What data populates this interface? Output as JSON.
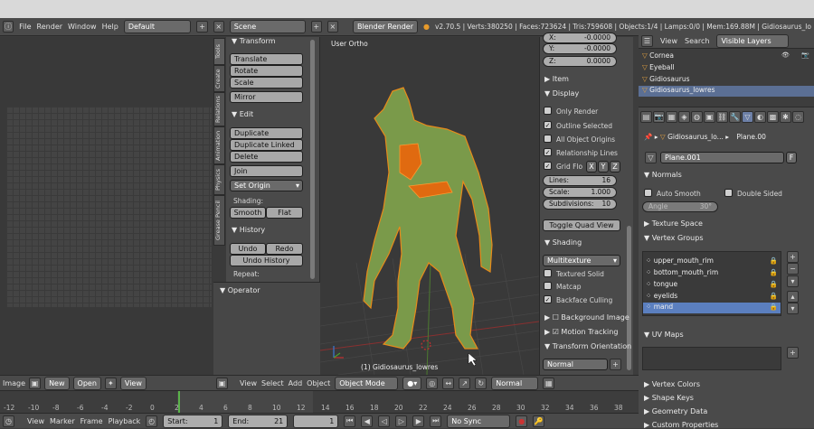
{
  "header": {
    "menus": [
      "File",
      "Render",
      "Window",
      "Help"
    ],
    "layout": "Default",
    "scene": "Scene",
    "engine": "Blender Render",
    "stats": "v2.70.5 | Verts:380250 | Faces:723624 | Tris:759608 | Objects:1/4 | Lamps:0/0 | Mem:169.88M | Gidiosaurus_lo"
  },
  "tool_tabs": [
    "Tools",
    "Create",
    "Relations",
    "Animation",
    "Physics",
    "Grease Pencil"
  ],
  "tools": {
    "transform_title": "Transform",
    "translate": "Translate",
    "rotate": "Rotate",
    "scale": "Scale",
    "mirror": "Mirror",
    "edit_title": "Edit",
    "duplicate": "Duplicate",
    "duplicate_linked": "Duplicate Linked",
    "delete": "Delete",
    "join": "Join",
    "set_origin": "Set Origin",
    "shading_label": "Shading:",
    "smooth": "Smooth",
    "flat": "Flat",
    "history_title": "History",
    "undo": "Undo",
    "redo": "Redo",
    "undo_history": "Undo History",
    "repeat_label": "Repeat:",
    "operator_title": "Operator"
  },
  "viewport": {
    "view_label": "User Ortho",
    "object_label": "(1) Gidiosaurus_lowres",
    "menus": [
      "View",
      "Select",
      "Add",
      "Object"
    ],
    "mode": "Object Mode",
    "pivot": "Normal"
  },
  "nprops": {
    "x_label": "X:",
    "x_val": "-0.0000",
    "y_label": "Y:",
    "y_val": "-0.0000",
    "z_label": "Z:",
    "z_val": "0.0000",
    "item": "Item",
    "display": "Display",
    "only_render": "Only Render",
    "outline_selected": "Outline Selected",
    "all_origins": "All Object Origins",
    "relationship_lines": "Relationship Lines",
    "grid_floor": "Grid Flo",
    "ax_x": "X",
    "ax_y": "Y",
    "ax_z": "Z",
    "lines_label": "Lines:",
    "lines_val": "16",
    "scale_label": "Scale:",
    "scale_val": "1.000",
    "subdiv_label": "Subdivisions:",
    "subdiv_val": "10",
    "toggle_quad": "Toggle Quad View",
    "shading_title": "Shading",
    "shading_mode": "Multitexture",
    "textured_solid": "Textured Solid",
    "matcap": "Matcap",
    "backface": "Backface Culling",
    "background_image": "Background Image",
    "motion_tracking": "Motion Tracking",
    "transform_orientation": "Transform Orientation",
    "orientation": "Normal"
  },
  "outliner": {
    "menus": [
      "View",
      "Search"
    ],
    "filter": "Visible Layers",
    "items": [
      "Cornea",
      "Eyeball",
      "Gidiosaurus",
      "Gidiosaurus_lowres"
    ]
  },
  "properties": {
    "breadcrumb_obj": "Gidiosaurus_lo...",
    "breadcrumb_mesh": "Plane.00",
    "mesh_name": "Plane.001",
    "fake_user": "F",
    "normals_title": "Normals",
    "auto_smooth": "Auto Smooth",
    "double_sided": "Double Sided",
    "angle_label": "Angle",
    "angle_val": "30°",
    "texture_space": "Texture Space",
    "vertex_groups": "Vertex Groups",
    "groups": [
      "upper_mouth_rim",
      "bottom_mouth_rim",
      "tongue",
      "eyelids",
      "mand"
    ],
    "uv_maps": "UV Maps",
    "vertex_colors": "Vertex Colors",
    "shape_keys": "Shape Keys",
    "geometry_data": "Geometry Data",
    "custom_properties": "Custom Properties"
  },
  "image_header": {
    "image": "Image",
    "new": "New",
    "open": "Open",
    "view": "View"
  },
  "timeline": {
    "ticks": [
      "-12",
      "-10",
      "-8",
      "-6",
      "-4",
      "-2",
      "0",
      "2",
      "4",
      "6",
      "8",
      "10",
      "12",
      "14",
      "16",
      "18",
      "20",
      "22",
      "24",
      "26",
      "28",
      "30",
      "32",
      "34",
      "36",
      "38"
    ],
    "menus": [
      "View",
      "Marker",
      "Frame",
      "Playback"
    ],
    "start": "Start:",
    "start_val": "1",
    "end": "End:",
    "end_val": "21",
    "current": "1",
    "sync": "No Sync"
  }
}
